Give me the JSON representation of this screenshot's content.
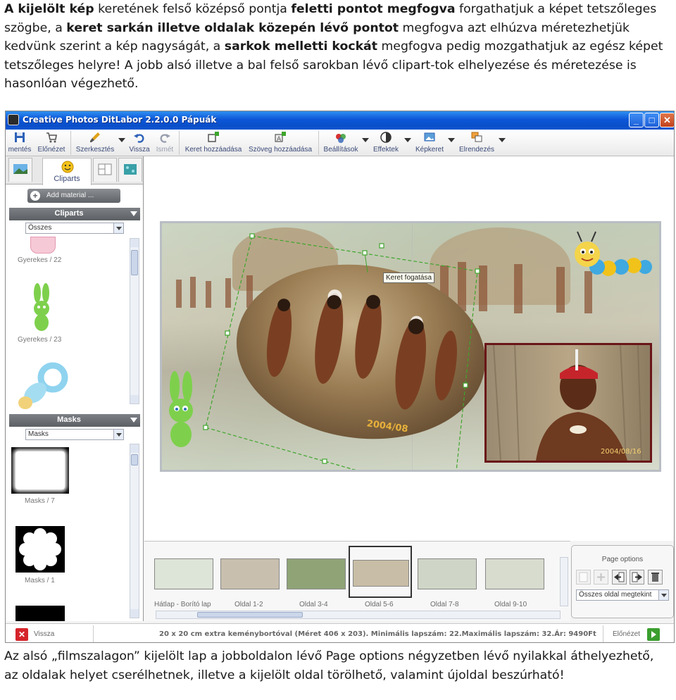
{
  "intro": {
    "segments": [
      {
        "text": "A kijelölt kép",
        "bold": true
      },
      {
        "text": " keretének felső középső pontja ",
        "bold": false
      },
      {
        "text": "feletti pontot megfogva",
        "bold": true
      },
      {
        "text": " forgathatjuk a képet tetszőleges szögbe, a ",
        "bold": false
      },
      {
        "text": "keret sarkán illetve oldalak közepén lévő pontot",
        "bold": true
      },
      {
        "text": " megfogva azt elhúzva méretezhetjük kedvünk szerint a kép nagyságát, a ",
        "bold": false
      },
      {
        "text": "sarkok melletti kockát",
        "bold": true
      },
      {
        "text": " megfogva pedig mozgathatjuk az egész képet tetszőleges helyre! A jobb alsó illetve a bal felső sarokban lévő clipart-tok elhelyezése és méretezése is hasonlóan végezhető.",
        "bold": false
      }
    ]
  },
  "window": {
    "title": "Creative Photos DitLabor 2.2.0.0 Pápuák",
    "min_symbol": "_",
    "max_symbol": "□",
    "close_symbol": "✕"
  },
  "toolbar": {
    "save": "mentés",
    "preview": "Előnézet",
    "edit": "Szerkesztés",
    "undo": "Vissza",
    "redo": "Ismét",
    "add_frame": "Keret hozzáadása",
    "add_text": "Szöveg hozzáadása",
    "settings": "Beállítások",
    "effects": "Effektek",
    "image_frame": "Képkeret",
    "arrange": "Elrendezés"
  },
  "left_panel": {
    "active_tab": "Cliparts",
    "add_material": "Add material ...",
    "cliparts_header": "Cliparts",
    "cliparts_filter": "Összes",
    "clipart_items": [
      "Gyerekes / 22",
      "Gyerekes / 23"
    ],
    "masks_header": "Masks",
    "masks_filter": "Masks",
    "mask_items": [
      "Masks / 7",
      "Masks / 1"
    ]
  },
  "canvas": {
    "tooltip": "Keret fogatása",
    "date_left": "2004/08",
    "date_right": "2004/08/16"
  },
  "filmstrip": {
    "pages": [
      {
        "label": "Hátlap - Borító lap",
        "selected": false
      },
      {
        "label": "Oldal 1-2",
        "selected": false
      },
      {
        "label": "Oldal 3-4",
        "selected": false
      },
      {
        "label": "Oldal 5-6",
        "selected": true
      },
      {
        "label": "Oldal 7-8",
        "selected": false
      },
      {
        "label": "Oldal 9-10",
        "selected": false
      }
    ]
  },
  "page_options": {
    "title": "Page options",
    "view_select": "Összes oldal megtekint"
  },
  "statusbar": {
    "back": "Vissza",
    "info": "20 x 20 cm extra keménybortóval (Méret 406 x 203). Minimális lapszám: 22.Maximális lapszám: 32.Ár: 9490Ft",
    "next": "Előnézet"
  },
  "outro": {
    "text": "Az alsó „filmszalagon” kijelölt lap a jobboldalon lévő Page options négyzetben lévő nyilakkal áthelyezhető, az oldalak helyet cserélhetnek, illetve a kijelölt oldal törölhető, valamint újoldal beszúrható!"
  },
  "colors": {
    "titlebar": "#0c56d8",
    "accent_label": "#3b4a78",
    "selection_dash": "#3fa52d",
    "photo_border": "#6a1618",
    "back_red": "#d6242b",
    "next_green": "#3a9e2e"
  }
}
